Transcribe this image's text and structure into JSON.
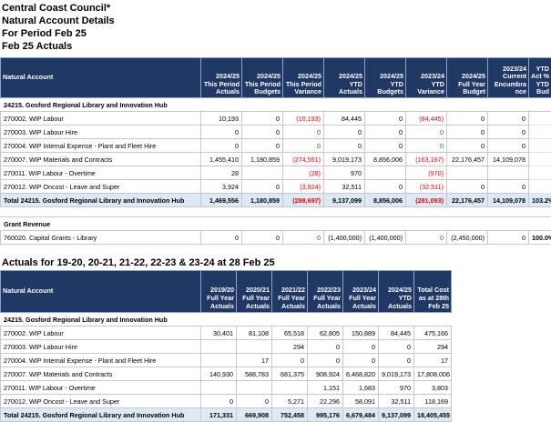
{
  "header": {
    "line1": "Central Coast Council*",
    "line2": "Natural Account Details",
    "line3": "For Period Feb 25",
    "line4": "Feb 25 Actuals"
  },
  "table1": {
    "columns": [
      "Natural Account",
      "2024/25 This Period Actuals",
      "2024/25 This Period Budgets",
      "2024/25 This Period Variance",
      "2024/25 YTD Actuals",
      "2024/25 YTD Budgets",
      "2023/24 YTD Variance",
      "2024/25 Full Year Budget",
      "2023/24 Current Encumbra nce",
      "YTD Act % YTD Bud"
    ],
    "section1_title": "24215. Gosford Regional Library and Innovation Hub",
    "rows": [
      [
        "270002. WIP Labour",
        "10,193",
        "0",
        "(10,193)",
        "84,445",
        "0",
        "(84,445)",
        "0",
        "0",
        ""
      ],
      [
        "270003. WIP Labour Hire",
        "0",
        "0",
        "0",
        "0",
        "0",
        "0",
        "0",
        "0",
        ""
      ],
      [
        "270004. WIP Internal Expense - Plant and Fleet Hire",
        "0",
        "0",
        "0",
        "0",
        "0",
        "0",
        "0",
        "0",
        ""
      ],
      [
        "270007. WIP Materials and Contracts",
        "1,455,410",
        "1,180,859",
        "(274,551)",
        "9,019,173",
        "8,856,006",
        "(163,167)",
        "22,176,457",
        "14,109,078",
        ""
      ],
      [
        "270011. WIP Labour - Overtime",
        "28",
        "",
        "(28)",
        "970",
        "",
        "(970)",
        "",
        "",
        ""
      ],
      [
        "270012. WIP Oncost - Leave and Super",
        "3,924",
        "0",
        "(3,924)",
        "32,511",
        "0",
        "(32,511)",
        "0",
        "0",
        ""
      ]
    ],
    "total": [
      "Total 24215. Gosford Regional Library and Innovation Hub",
      "1,469,556",
      "1,180,859",
      "(288,697)",
      "9,137,099",
      "8,856,006",
      "(281,093)",
      "22,176,457",
      "14,109,078",
      "103.2%"
    ],
    "grant_title": "Grant Revenue",
    "grant_row": [
      "760020. Capital Grants - Library",
      "0",
      "0",
      "0",
      "(1,400,000)",
      "(1,400,000)",
      "0",
      "(2,450,000)",
      "0",
      "100.0%"
    ]
  },
  "section2_title": "Actuals for 19-20, 20-21, 21-22, 22-23 & 23-24  at 28 Feb 25",
  "table2": {
    "columns": [
      "Natural Account",
      "2019/20 Full Year Actuals",
      "2020/21 Full Year Actuals",
      "2021/22 Full Year Actuals",
      "2022/23 Full Year Actuals",
      "2023/24 Full Year Actuals",
      "2024/25 YTD Actuals",
      "Total Cost as at 28th Feb 25"
    ],
    "section_title": "24215. Gosford Regional Library and Innovation Hub",
    "rows": [
      [
        "270002. WIP Labour",
        "30,401",
        "81,108",
        "65,518",
        "62,805",
        "150,889",
        "84,445",
        "475,166"
      ],
      [
        "270003. WIP Labour Hire",
        "",
        "",
        "294",
        "0",
        "0",
        "0",
        "294"
      ],
      [
        "270004. WIP Internal Expense - Plant and Fleet Hire",
        "",
        "17",
        "0",
        "0",
        "0",
        "0",
        "17"
      ],
      [
        "270007. WIP Materials and Contracts",
        "140,930",
        "588,783",
        "681,375",
        "908,924",
        "6,468,820",
        "9,019,173",
        "17,808,006"
      ],
      [
        "270011. WIP Labour - Overtime",
        "",
        "",
        "",
        "1,151",
        "1,683",
        "970",
        "3,803"
      ],
      [
        "270012. WIP Oncost - Leave and Super",
        "0",
        "0",
        "5,271",
        "22,296",
        "58,091",
        "32,511",
        "118,169"
      ]
    ],
    "total": [
      "Total 24215. Gosford Regional Library and Innovation Hub",
      "171,331",
      "669,908",
      "752,458",
      "995,176",
      "6,679,484",
      "9,137,099",
      "18,405,455"
    ]
  },
  "colors": {
    "header_bg": "#1f3864",
    "total_bg": "#dce9f7",
    "negative": "#ff0000",
    "zero_variance": "#00a000"
  }
}
